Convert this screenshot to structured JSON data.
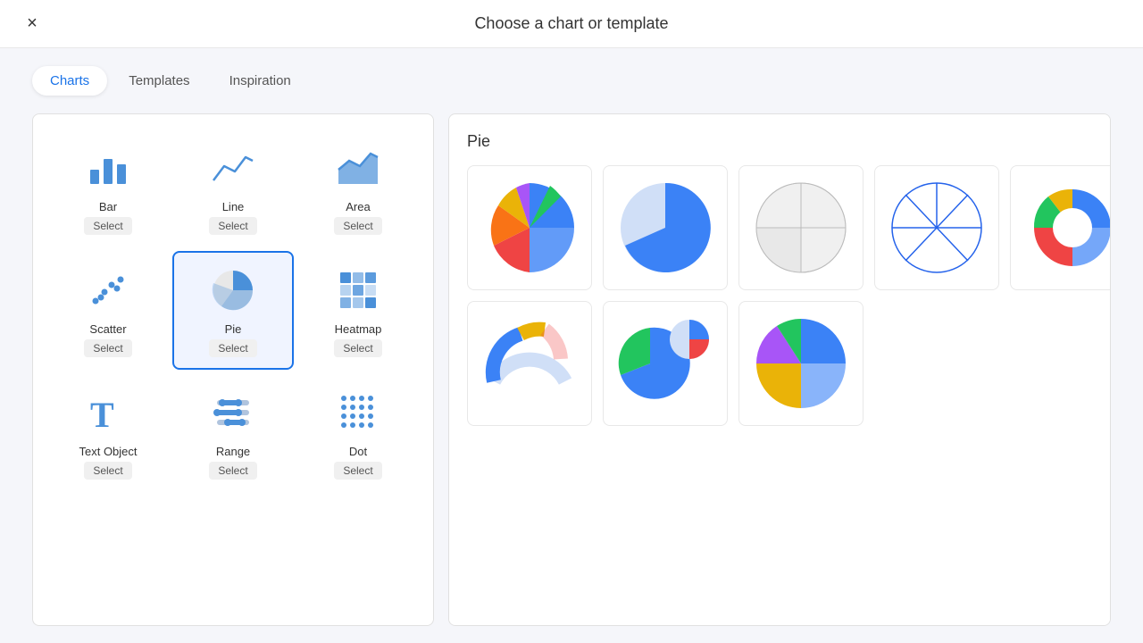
{
  "header": {
    "title": "Choose a chart or template",
    "close_label": "×"
  },
  "tabs": [
    {
      "id": "charts",
      "label": "Charts",
      "active": true
    },
    {
      "id": "templates",
      "label": "Templates",
      "active": false
    },
    {
      "id": "inspiration",
      "label": "Inspiration",
      "active": false
    }
  ],
  "sidebar": {
    "charts": [
      {
        "id": "bar",
        "name": "Bar",
        "select": "Select",
        "selected": false
      },
      {
        "id": "line",
        "name": "Line",
        "select": "Select",
        "selected": false
      },
      {
        "id": "area",
        "name": "Area",
        "select": "Select",
        "selected": false
      },
      {
        "id": "scatter",
        "name": "Scatter",
        "select": "Select",
        "selected": false
      },
      {
        "id": "pie",
        "name": "Pie",
        "select": "Select",
        "selected": true
      },
      {
        "id": "heatmap",
        "name": "Heatmap",
        "select": "Select",
        "selected": false
      },
      {
        "id": "text",
        "name": "Text Object",
        "select": "Select",
        "selected": false
      },
      {
        "id": "range",
        "name": "Range",
        "select": "Select",
        "selected": false
      },
      {
        "id": "dot",
        "name": "Dot",
        "select": "Select",
        "selected": false
      }
    ]
  },
  "pie_section": {
    "title": "Pie",
    "thumbnails": [
      {
        "id": "pie1",
        "style": "colorful"
      },
      {
        "id": "pie2",
        "style": "two-tone"
      },
      {
        "id": "pie3",
        "style": "outline-light"
      },
      {
        "id": "pie4",
        "style": "outline-dark"
      },
      {
        "id": "pie5",
        "style": "donut"
      },
      {
        "id": "pie6",
        "style": "gauge"
      },
      {
        "id": "pie7",
        "style": "multi-pie"
      },
      {
        "id": "pie8",
        "style": "colorful2"
      }
    ]
  },
  "colors": {
    "accent": "#1a73e8",
    "selected_bg": "#f0f4ff"
  }
}
